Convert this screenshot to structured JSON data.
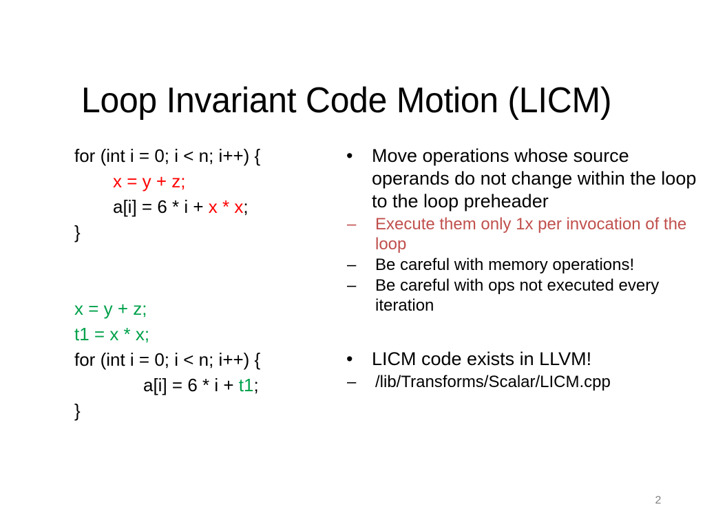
{
  "slide": {
    "title": "Loop Invariant Code Motion (LICM)",
    "page_number": "2",
    "colors": {
      "background": "#FFFFFF",
      "text": "#000000",
      "highlight_red": "#FF0000",
      "highlight_green": "#00A14B",
      "accent_sub_bullet": "#C0504D",
      "page_number": "#808080"
    }
  },
  "code_before": {
    "label": "original-loop",
    "lines": [
      {
        "indent": 0,
        "tokens": [
          {
            "text": "for (int i = 0; i < n; i++) {",
            "color": "black"
          }
        ]
      },
      {
        "indent": 1,
        "tokens": [
          {
            "text": "x = y + z;",
            "color": "red"
          }
        ]
      },
      {
        "indent": 1,
        "tokens": [
          {
            "text": "a[i] = 6 * i + ",
            "color": "black"
          },
          {
            "text": "x * x",
            "color": "red"
          },
          {
            "text": ";",
            "color": "black"
          }
        ]
      },
      {
        "indent": 0,
        "tokens": [
          {
            "text": "}",
            "color": "black"
          }
        ]
      }
    ]
  },
  "code_after": {
    "label": "transformed-loop",
    "lines": [
      {
        "indent": 0,
        "tokens": [
          {
            "text": "x = y + z;",
            "color": "green"
          }
        ]
      },
      {
        "indent": 0,
        "tokens": [
          {
            "text": "t1 = x * x;",
            "color": "green"
          }
        ]
      },
      {
        "indent": 0,
        "tokens": [
          {
            "text": "for (int i = 0; i < n; i++) {",
            "color": "black"
          }
        ]
      },
      {
        "indent": 2,
        "tokens": [
          {
            "text": "a[i] = 6 * i + ",
            "color": "black"
          },
          {
            "text": "t1",
            "color": "green"
          },
          {
            "text": ";",
            "color": "black"
          }
        ]
      },
      {
        "indent": 0,
        "tokens": [
          {
            "text": "}",
            "color": "black"
          }
        ]
      }
    ]
  },
  "bullets": [
    {
      "level": 1,
      "marker": "•",
      "text": "Move operations whose source operands do not change within the loop to the loop preheader",
      "accent": false
    },
    {
      "level": 2,
      "marker": "–",
      "text": "Execute them only 1x per invocation of the loop",
      "accent": true
    },
    {
      "level": 2,
      "marker": "–",
      "text": "Be careful with memory operations!",
      "accent": false
    },
    {
      "level": 2,
      "marker": "–",
      "text": "Be careful with ops not executed every iteration",
      "accent": false
    },
    {
      "level": 1,
      "marker": "•",
      "text": "LICM code exists in LLVM!",
      "accent": false
    },
    {
      "level": 2,
      "marker": "–",
      "text": "/lib/Transforms/Scalar/LICM.cpp",
      "accent": false
    }
  ]
}
